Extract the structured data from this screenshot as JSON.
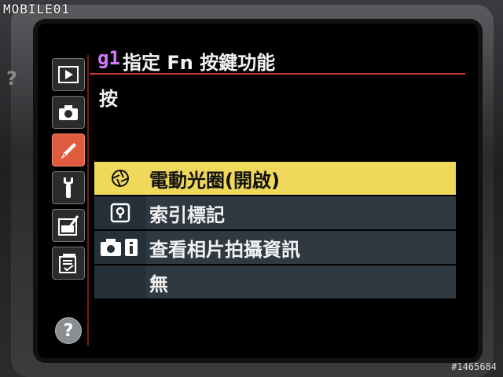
{
  "watermark": "MOBILE01",
  "photo_id": "#1465684",
  "outer_help": "?",
  "menu_code": "g1",
  "menu_title": "指定 Fn 按鍵功能",
  "sub_label": "按",
  "options": [
    {
      "label": "電動光圈(開啟)",
      "icon": "aperture-icon",
      "selected": true
    },
    {
      "label": "索引標記",
      "icon": "index-mark-icon",
      "selected": false
    },
    {
      "label": "查看相片拍攝資訊",
      "icon": "camera-info-icon",
      "selected": false
    },
    {
      "label": "無",
      "icon": "",
      "selected": false
    }
  ],
  "tabs": [
    {
      "name": "playback-menu",
      "icon": "playback-icon",
      "active": false
    },
    {
      "name": "shooting-menu",
      "icon": "camera-icon",
      "active": false
    },
    {
      "name": "custom-settings",
      "icon": "pencil-icon",
      "active": true
    },
    {
      "name": "setup-menu",
      "icon": "wrench-icon",
      "active": false
    },
    {
      "name": "retouch-menu",
      "icon": "retouch-icon",
      "active": false
    },
    {
      "name": "my-menu",
      "icon": "my-menu-icon",
      "active": false
    }
  ],
  "help_label": "?",
  "colors": {
    "selected": "#f0d85a",
    "accent_red": "#c63a2b",
    "code_purple": "#d777ff"
  }
}
